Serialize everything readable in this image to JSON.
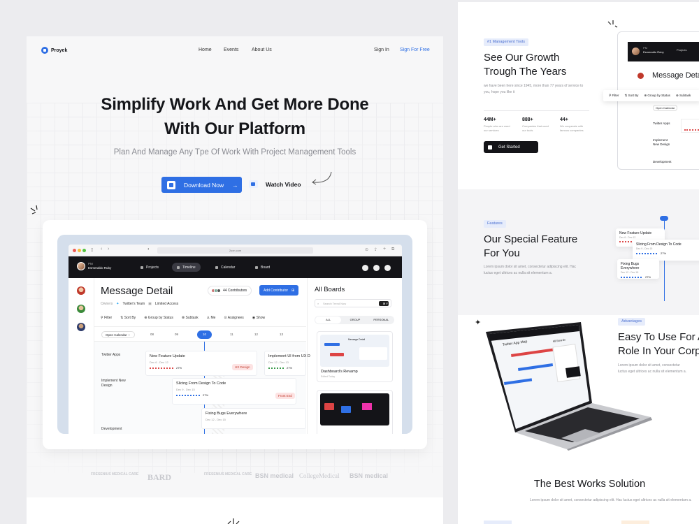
{
  "left": {
    "brand": "Proyek",
    "nav": [
      "Home",
      "Events",
      "About Us"
    ],
    "sign_in": "Sign In",
    "sign_up": "Sign For Free",
    "hero_title_1": "Simplify Work And Get More Done",
    "hero_title_2": "With Our Platform",
    "hero_sub": "Plan And Manage Any Tpe Of Work With Project Management Tools",
    "download_label": "Download Now",
    "watch_label": "Watch Video",
    "app": {
      "url": "2uxn.com",
      "user_role": "PM",
      "user_name": "Esmeraldo Ruby",
      "tabs": [
        "Projects",
        "Timeline",
        "Calendar",
        "Board"
      ],
      "title": "Message Detail",
      "owners_label": "Owners",
      "team": "Twitter's Team",
      "access": "Limited Access",
      "contributors": "44 Contributors",
      "add_contributor": "Add Contributor",
      "filters": [
        "Filter",
        "Sort By",
        "Group by Status",
        "Subtask",
        "Me",
        "Assignees",
        "Show"
      ],
      "open_calendar": "Open Calendar",
      "dates": [
        "08",
        "09",
        "10",
        "11",
        "12",
        "13"
      ],
      "rows": [
        "Twitter Apps",
        "Implement New Design",
        "Development"
      ],
      "tasks": [
        {
          "title": "New Feature Update",
          "date": "Dec 6 - Dec 12",
          "pct": "27%",
          "tag": "UX Design"
        },
        {
          "title": "Implement UI from UX D",
          "date": "Dec 12 - Dec 13",
          "pct": "27%"
        },
        {
          "title": "Slicing From Design To Code",
          "date": "Dec 9 - Dec 15",
          "pct": "27%",
          "tag": "Front End"
        },
        {
          "title": "Fixing Bugs Everywhere",
          "date": "Dec 12 - Dec 15"
        }
      ],
      "boards_title": "All Boards",
      "search_placeholder": "Search Trend Now",
      "search_shortcut": "⌘ F",
      "segments": [
        "ALL",
        "GROUP",
        "PERSONAL"
      ],
      "board_card": "Dashboard's Revamp",
      "board_card_sub": "Edited Today",
      "board_thumb_title": "Message Detail"
    },
    "brands": [
      "FRESENIUS MEDICAL CARE",
      "BARD",
      "FRESENIUS MEDICAL CARE",
      "BSN medical",
      "CollegeMedical",
      "BSN medical"
    ]
  },
  "right": {
    "badge1": "#1 Management Tools",
    "growth_1": "See Our Growth",
    "growth_2": "Trough The Years",
    "growth_p1": "we have been here since 1945, more than 77 years of service to",
    "growth_p2": "you, hope you like it",
    "stats": [
      {
        "n": "44M+",
        "l1": "People who are used",
        "l2": "our services"
      },
      {
        "n": "888+",
        "l1": "Companies that used",
        "l2": "our tools"
      },
      {
        "n": "44+",
        "l1": "We cooperate with",
        "l2": "famous companies"
      }
    ],
    "get_started": "Get Started",
    "mock_user_role": "PM",
    "mock_user_name": "Esmeraldo Ruby",
    "mock_tab": "Projects",
    "mock_title": "Message Detail",
    "float_filters": [
      "Filter",
      "Sort By",
      "Group by Status",
      "Subtask"
    ],
    "mock_open_calendar": "Open Calendar",
    "mock_rows": [
      "Twitter Apps",
      "Implement New Design",
      "Development"
    ],
    "badge2": "Features",
    "feature_1": "Our Special Feature",
    "feature_2": "For You",
    "feature_p1": "Lorem ipsum dolor sit amet, consectetur adipiscing elit. Hac",
    "feature_p2": "luctus eget ultrices ac nulla sit elementum a.",
    "feature_cards": [
      {
        "title": "New Feature Update",
        "date": "Dec 6 - Dec 12"
      },
      {
        "title": "Slicing From Design To Code",
        "date": "Dec 9 - Dec 15",
        "pct": "27%"
      },
      {
        "title": "Fixing Bugs Everywhere",
        "date": "Dec 12 - Dec 18",
        "pct": "27%"
      }
    ],
    "badge3": "Advantages",
    "adv_1": "Easy To Use For A",
    "adv_2": "Role In Your Corp",
    "adv_p1": "Lorem ipsum dolor sit amet, consectetur",
    "adv_p2": "luctus eget ultrices ac nulla sit elementum a.",
    "laptop_screen_title": "Twitter App Map",
    "laptop_board": "All Boards",
    "bottom_title": "The Best Works Solution",
    "bottom_sub": "Lorem ipsum dolor sit amet, consectetur adipiscing elit. Hac luctus eget ultrices ac nulla sit elementum a."
  },
  "colors": {
    "accent": "#2f6fe4",
    "dark": "#141418",
    "danger": "#dd4b4b"
  }
}
